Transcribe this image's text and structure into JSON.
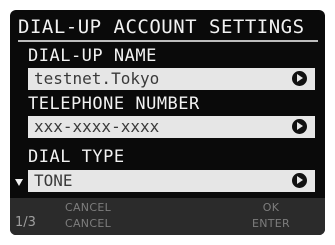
{
  "title": "DIAL-UP ACCOUNT SETTINGS",
  "fields": [
    {
      "label": "DIAL-UP NAME",
      "value": "testnet.Tokyo"
    },
    {
      "label": "TELEPHONE NUMBER",
      "value": "xxx-xxxx-xxxx"
    },
    {
      "label": "DIAL TYPE",
      "value": "TONE"
    }
  ],
  "footer": {
    "page": "1/3",
    "cancel_top": "CANCEL",
    "cancel_bottom": "CANCEL",
    "ok": "OK",
    "enter": "ENTER"
  },
  "icons": {
    "field_action": "chevron-right-circle-icon",
    "scroll": "triangle-down-icon"
  }
}
